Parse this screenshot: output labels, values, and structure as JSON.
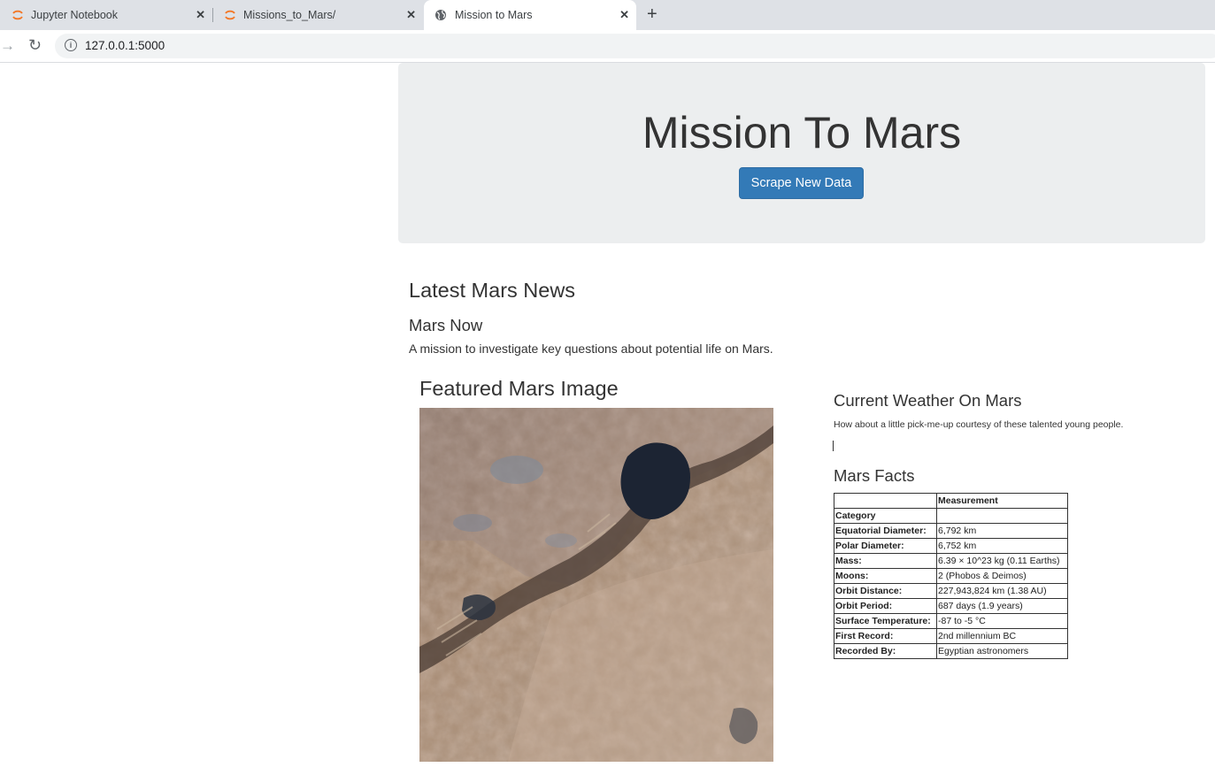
{
  "browser": {
    "tabs": [
      {
        "label": "Jupyter Notebook",
        "icon": "jupyter-icon"
      },
      {
        "label": "Missions_to_Mars/",
        "icon": "jupyter-icon"
      },
      {
        "label": "Mission to Mars",
        "icon": "globe-icon",
        "active": true
      }
    ],
    "new_tab_glyph": "+",
    "close_glyph": "✕",
    "url": "127.0.0.1:5000"
  },
  "jumbotron": {
    "title": "Mission To Mars",
    "button_label": "Scrape New Data",
    "button_color": "#337ab7"
  },
  "news": {
    "heading": "Latest Mars News",
    "title": "Mars Now",
    "paragraph": "A mission to investigate key questions about potential life on Mars."
  },
  "featured_image": {
    "heading": "Featured Mars Image"
  },
  "weather": {
    "heading": "Current Weather On Mars",
    "text": "How about a little pick-me-up courtesy of these talented young people."
  },
  "facts": {
    "heading": "Mars Facts",
    "header": [
      "",
      "Measurement"
    ],
    "index_label": "Category",
    "rows": [
      [
        "Equatorial Diameter:",
        "6,792 km"
      ],
      [
        "Polar Diameter:",
        "6,752 km"
      ],
      [
        "Mass:",
        "6.39 × 10^23 kg (0.11 Earths)"
      ],
      [
        "Moons:",
        "2 (Phobos & Deimos)"
      ],
      [
        "Orbit Distance:",
        "227,943,824 km (1.38 AU)"
      ],
      [
        "Orbit Period:",
        "687 days (1.9 years)"
      ],
      [
        "Surface Temperature:",
        "-87 to -5 °C"
      ],
      [
        "First Record:",
        "2nd millennium BC"
      ],
      [
        "Recorded By:",
        "Egyptian astronomers"
      ]
    ]
  }
}
